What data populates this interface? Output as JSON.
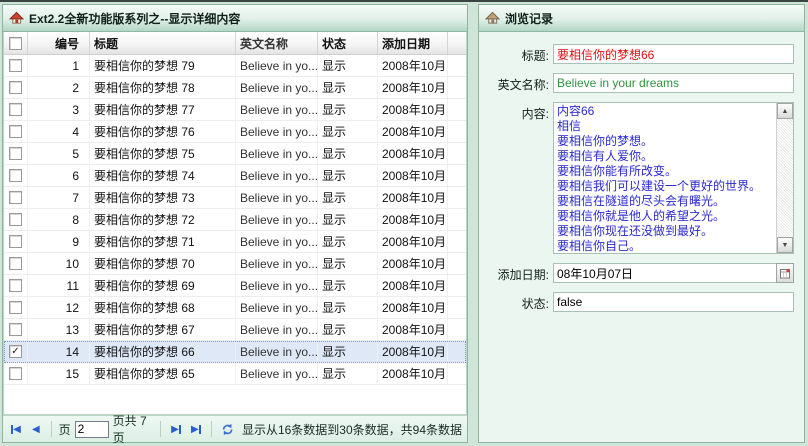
{
  "left_panel": {
    "title": "Ext2.2全新功能版系列之--显示详细内容",
    "grid": {
      "columns": {
        "num": "编号",
        "title": "标题",
        "en": "英文名称",
        "status": "状态",
        "date": "添加日期"
      },
      "rows": [
        {
          "num": "1",
          "title": "要相信你的梦想  79",
          "en": "Believe in yo...",
          "status": "显示",
          "date": "2008年10月...",
          "checked": false,
          "selected": false
        },
        {
          "num": "2",
          "title": "要相信你的梦想  78",
          "en": "Believe in yo...",
          "status": "显示",
          "date": "2008年10月...",
          "checked": false,
          "selected": false
        },
        {
          "num": "3",
          "title": "要相信你的梦想  77",
          "en": "Believe in yo...",
          "status": "显示",
          "date": "2008年10月...",
          "checked": false,
          "selected": false
        },
        {
          "num": "4",
          "title": "要相信你的梦想  76",
          "en": "Believe in yo...",
          "status": "显示",
          "date": "2008年10月...",
          "checked": false,
          "selected": false
        },
        {
          "num": "5",
          "title": "要相信你的梦想  75",
          "en": "Believe in yo...",
          "status": "显示",
          "date": "2008年10月...",
          "checked": false,
          "selected": false
        },
        {
          "num": "6",
          "title": "要相信你的梦想  74",
          "en": "Believe in yo...",
          "status": "显示",
          "date": "2008年10月...",
          "checked": false,
          "selected": false
        },
        {
          "num": "7",
          "title": "要相信你的梦想  73",
          "en": "Believe in yo...",
          "status": "显示",
          "date": "2008年10月...",
          "checked": false,
          "selected": false
        },
        {
          "num": "8",
          "title": "要相信你的梦想  72",
          "en": "Believe in yo...",
          "status": "显示",
          "date": "2008年10月...",
          "checked": false,
          "selected": false
        },
        {
          "num": "9",
          "title": "要相信你的梦想  71",
          "en": "Believe in yo...",
          "status": "显示",
          "date": "2008年10月...",
          "checked": false,
          "selected": false
        },
        {
          "num": "10",
          "title": "要相信你的梦想  70",
          "en": "Believe in yo...",
          "status": "显示",
          "date": "2008年10月...",
          "checked": false,
          "selected": false
        },
        {
          "num": "11",
          "title": "要相信你的梦想  69",
          "en": "Believe in yo...",
          "status": "显示",
          "date": "2008年10月...",
          "checked": false,
          "selected": false
        },
        {
          "num": "12",
          "title": "要相信你的梦想  68",
          "en": "Believe in yo...",
          "status": "显示",
          "date": "2008年10月...",
          "checked": false,
          "selected": false
        },
        {
          "num": "13",
          "title": "要相信你的梦想  67",
          "en": "Believe in yo...",
          "status": "显示",
          "date": "2008年10月...",
          "checked": false,
          "selected": false
        },
        {
          "num": "14",
          "title": "要相信你的梦想  66",
          "en": "Believe in yo...",
          "status": "显示",
          "date": "2008年10月...",
          "checked": true,
          "selected": true
        },
        {
          "num": "15",
          "title": "要相信你的梦想  65",
          "en": "Believe in yo...",
          "status": "显示",
          "date": "2008年10月...",
          "checked": false,
          "selected": false
        }
      ]
    },
    "paging": {
      "page_label": "页",
      "page_value": "2",
      "pages_label": "页共 7页",
      "status_text": "显示从16条数据到30条数据，共94条数据"
    }
  },
  "right_panel": {
    "title": "浏览记录",
    "fields": {
      "title": {
        "label": "标题:",
        "value": "要相信你的梦想66"
      },
      "en_name": {
        "label": "英文名称:",
        "value": "Believe in your dreams"
      },
      "content": {
        "label": "内容:",
        "value": "内容66\n相信\n要相信你的梦想。\n要相信有人爱你。\n要相信你能有所改变。\n要相信我们可以建设一个更好的世界。\n要相信在隧道的尽头会有曙光。\n要相信你就是他人的希望之光。\n要相信你现在还没做到最好。\n要相信你自己。"
      },
      "date": {
        "label": "添加日期:",
        "value": "08年10月07日"
      },
      "status": {
        "label": "状态:",
        "value": "false"
      }
    }
  },
  "colors": {
    "accent_blue": "#2a5fd0",
    "title_value_red": "#dd1111",
    "en_value_green": "#2e9440",
    "content_blue": "#2a2ace",
    "selected_row": "#dfe8f6",
    "theme_green": "#b4d6c5"
  }
}
